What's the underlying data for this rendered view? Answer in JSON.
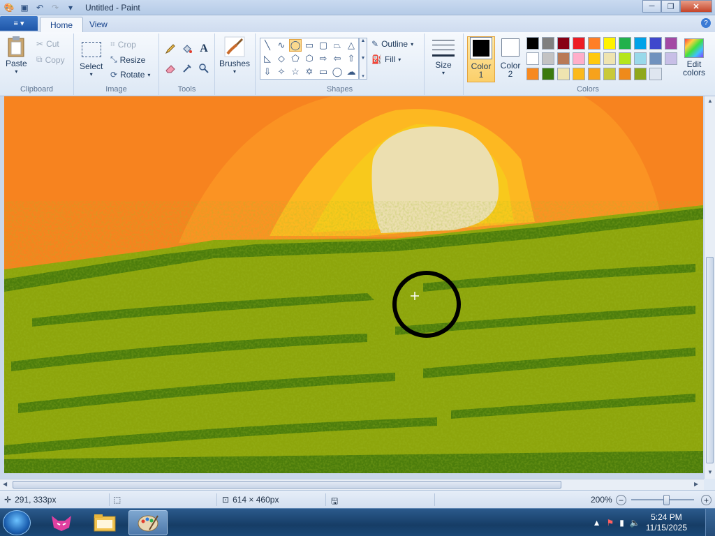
{
  "window": {
    "title": "Untitled - Paint"
  },
  "quick_access": {
    "icons": [
      "paint-app-icon",
      "save-icon",
      "undo-icon",
      "redo-icon",
      "customize-icon"
    ]
  },
  "window_controls": {
    "minimize": "─",
    "maximize": "❐",
    "close": "✕"
  },
  "tabs": {
    "app_menu": "≡ ▾",
    "home": "Home",
    "view": "View"
  },
  "help": "?",
  "ribbon": {
    "clipboard": {
      "label": "Clipboard",
      "paste": "Paste",
      "cut": "Cut",
      "copy": "Copy"
    },
    "image": {
      "label": "Image",
      "select": "Select",
      "crop": "Crop",
      "resize": "Resize",
      "rotate": "Rotate"
    },
    "tools": {
      "label": "Tools",
      "items": [
        "pencil-icon",
        "fill-icon",
        "text-icon",
        "eraser-icon",
        "color-picker-icon",
        "magnifier-icon"
      ],
      "text_glyph": "A"
    },
    "brushes": {
      "label": "Brushes"
    },
    "shapes": {
      "label": "Shapes",
      "outline": "Outline",
      "fill": "Fill",
      "selected": "oval"
    },
    "size": {
      "label": "Size"
    },
    "colors": {
      "label": "Colors",
      "color1_label": "Color",
      "color1_num": "1",
      "color2_label": "Color",
      "color2_num": "2",
      "color1": "#000000",
      "color2": "#ffffff",
      "edit_label": "Edit colors",
      "row1": [
        "#000000",
        "#7f7f7f",
        "#880015",
        "#ed1c24",
        "#ff7f27",
        "#fff200",
        "#22b14c",
        "#00a2e8",
        "#3f48cc",
        "#a349a4"
      ],
      "row2": [
        "#ffffff",
        "#c3c3c3",
        "#b97a57",
        "#ffaec9",
        "#ffc90e",
        "#efe4b0",
        "#b5e61d",
        "#99d9ea",
        "#7092be",
        "#c8bfe7"
      ],
      "row3": [
        "#f7891f",
        "#3b7a0f",
        "#efe4b0",
        "#fbb91c",
        "#f7a21b",
        "#c9c93a",
        "#ef8a1a",
        "#8fa81c",
        "#dfe6f0"
      ]
    }
  },
  "status": {
    "cursor_pos": "291, 333px",
    "image_size": "614 × 460px",
    "zoom": "200%"
  },
  "taskbar": {
    "time": "5:24 PM",
    "date": "11/15/2025"
  },
  "canvas_painting": {
    "sky_color": "#f7831f",
    "sun_color": "#ecdfb0",
    "grass_color": "#8da50c",
    "grass_dark": "#4c7d0c",
    "circle_color": "#000000"
  }
}
